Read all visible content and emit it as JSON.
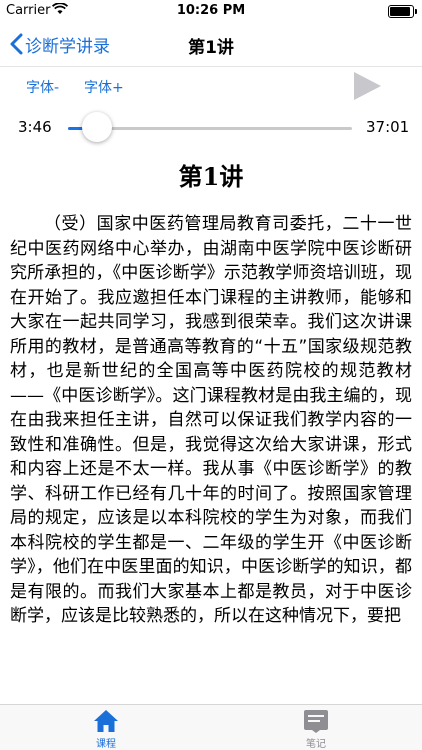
{
  "status_bar": {
    "carrier": "Carrier",
    "time": "10:26 PM"
  },
  "nav": {
    "back_label": "诊断学讲录",
    "title": "第1讲"
  },
  "controls": {
    "font_decrease": "字体-",
    "font_increase": "字体+",
    "current_time": "3:46",
    "total_time": "37:01",
    "progress_fraction": 0.102
  },
  "lecture": {
    "heading": "第1讲",
    "body": "（受）国家中医药管理局教育司委托，二十一世纪中医药网络中心举办，由湖南中医学院中医诊断研究所承担的，《中医诊断学》示范教学师资培训班，现在开始了。我应邀担任本门课程的主讲教师，能够和大家在一起共同学习，我感到很荣幸。我们这次讲课所用的教材，是普通高等教育的“十五”国家级规范教材，也是新世纪的全国高等中医药院校的规范教材——《中医诊断学》。这门课程教材是由我主编的，现在由我来担任主讲，自然可以保证我们教学内容的一致性和准确性。但是，我觉得这次给大家讲课，形式和内容上还是不太一样。我从事《中医诊断学》的教学、科研工作已经有几十年的时间了。按照国家管理局的规定，应该是以本科院校的学生为对象，而我们本科院校的学生都是一、二年级的学生开《中医诊断学》，他们在中医里面的知识，中医诊断学的知识，都是有限的。而我们大家基本上都是教员，对于中医诊断学，应该是比较熟悉的，所以在这种情况下，要把"
  },
  "tabbar": {
    "tabs": [
      {
        "label": "课程",
        "icon": "home-icon",
        "active": true
      },
      {
        "label": "笔记",
        "icon": "notes-icon",
        "active": false
      }
    ]
  },
  "colors": {
    "accent": "#1a6fd9",
    "inactive": "#8e8e93",
    "play_disabled": "#c7c7cc"
  }
}
